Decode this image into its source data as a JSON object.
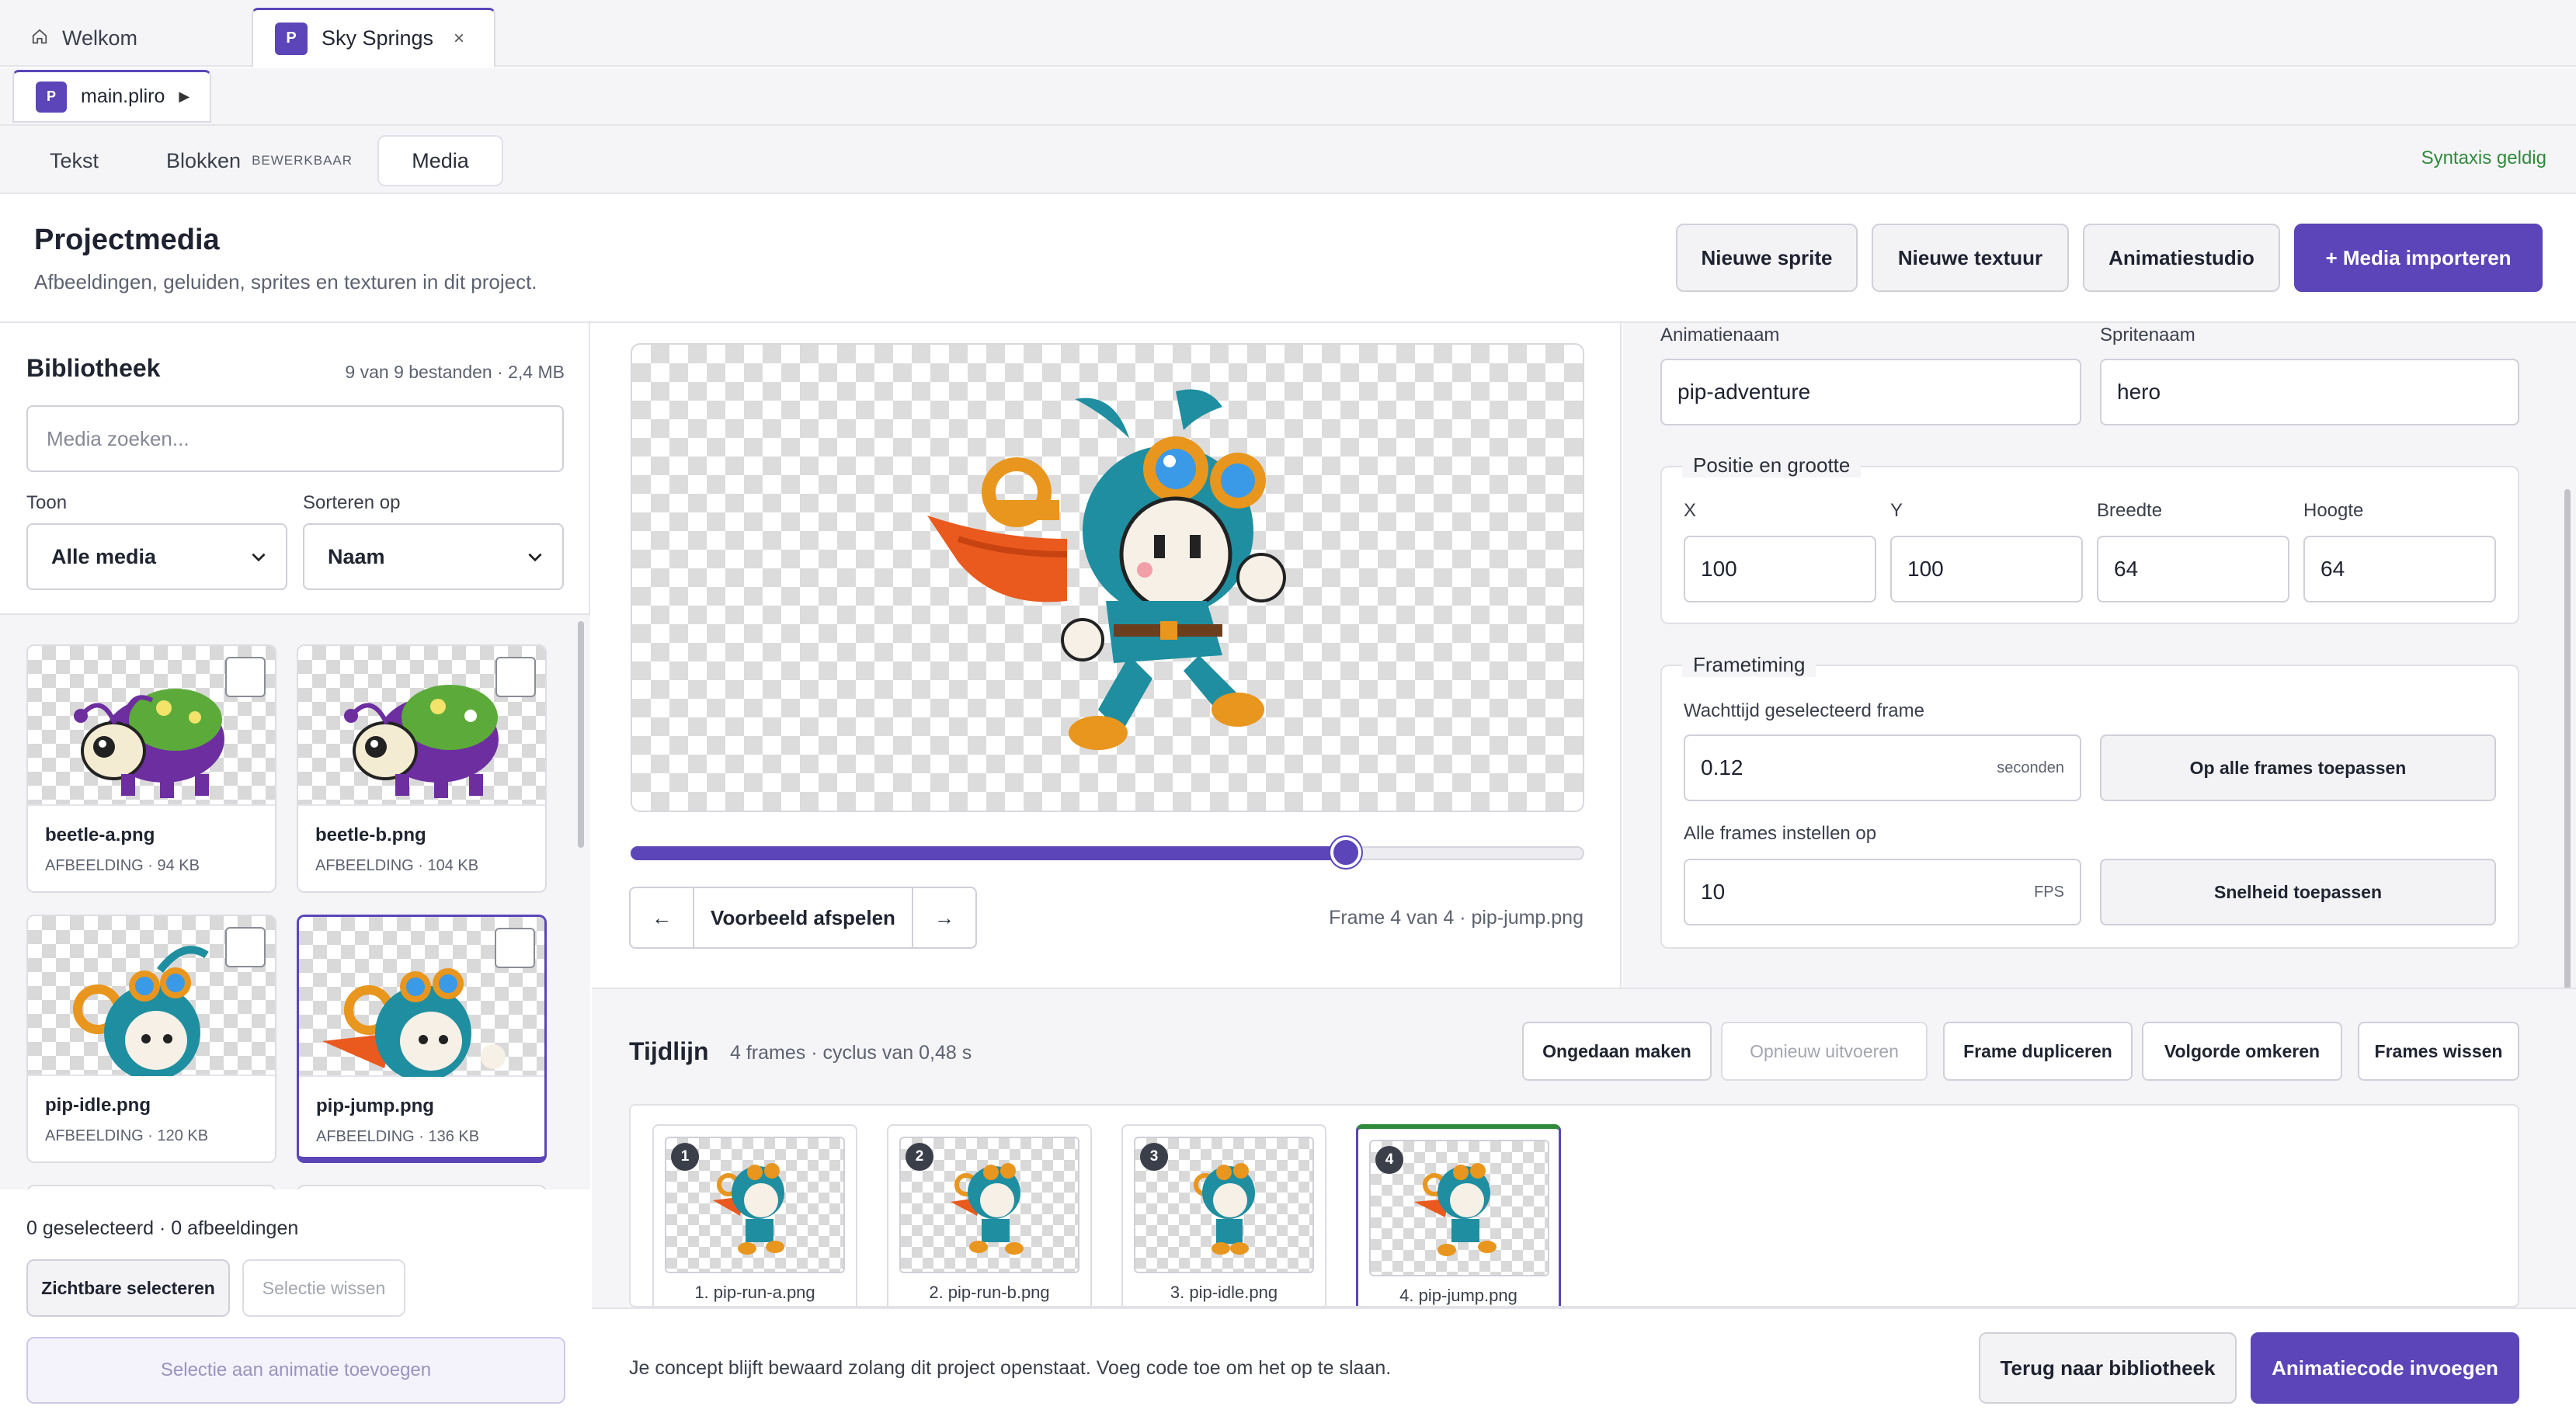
{
  "tabs": {
    "home_label": "Welkom",
    "project_label": "Sky Springs",
    "project_badge": "P",
    "close": "×"
  },
  "file": {
    "badge": "P",
    "name": "main.pliro"
  },
  "modes": {
    "text": "Tekst",
    "blocks": "Blokken",
    "blocks_badge": "BEWERKBAAR",
    "media": "Media",
    "syntax_status": "Syntaxis geldig"
  },
  "header": {
    "title": "Projectmedia",
    "subtitle": "Afbeeldingen, geluiden, sprites en texturen in dit project.",
    "btn_new_sprite": "Nieuwe sprite",
    "btn_new_texture": "Nieuwe textuur",
    "btn_anim_studio": "Animatiestudio",
    "btn_import": "+ Media importeren"
  },
  "library": {
    "title": "Bibliotheek",
    "count": "9 van 9 bestanden · 2,4 MB",
    "search_placeholder": "Media zoeken...",
    "show_label": "Toon",
    "show_value": "Alle media",
    "sort_label": "Sorteren op",
    "sort_value": "Naam",
    "items": [
      {
        "name": "beetle-a.png",
        "meta": "AFBEELDING · 94 KB"
      },
      {
        "name": "beetle-b.png",
        "meta": "AFBEELDING · 104 KB"
      },
      {
        "name": "pip-idle.png",
        "meta": "AFBEELDING · 120 KB"
      },
      {
        "name": "pip-jump.png",
        "meta": "AFBEELDING · 136 KB"
      }
    ],
    "selection_info": "0 geselecteerd · 0 afbeeldingen",
    "btn_select_visible": "Zichtbare selecteren",
    "btn_clear_selection": "Selectie wissen",
    "btn_add_to_animation": "Selectie aan animatie toevoegen"
  },
  "preview": {
    "progress": 0.75,
    "btn_prev": "←",
    "btn_play": "Voorbeeld afspelen",
    "btn_next": "→",
    "frame_info": "Frame 4 van 4 · pip-jump.png"
  },
  "settings": {
    "anim_name_label": "Animatienaam",
    "anim_name_value": "pip-adventure",
    "sprite_name_label": "Spritenaam",
    "sprite_name_value": "hero",
    "pos_legend": "Positie en grootte",
    "x_label": "X",
    "x_value": "100",
    "y_label": "Y",
    "y_value": "100",
    "w_label": "Breedte",
    "w_value": "64",
    "h_label": "Hoogte",
    "h_value": "64",
    "timing_legend": "Frametiming",
    "wait_label": "Wachttijd geselecteerd frame",
    "wait_value": "0.12",
    "wait_unit": "seconden",
    "btn_apply_all": "Op alle frames toepassen",
    "all_frames_label": "Alle frames instellen op",
    "fps_value": "10",
    "fps_unit": "FPS",
    "btn_apply_speed": "Snelheid toepassen"
  },
  "timeline": {
    "title": "Tijdlijn",
    "subtitle": "4 frames · cyclus van 0,48 s",
    "btn_undo": "Ongedaan maken",
    "btn_redo": "Opnieuw uitvoeren",
    "btn_duplicate": "Frame dupliceren",
    "btn_reverse": "Volgorde omkeren",
    "btn_clear": "Frames wissen",
    "frames": [
      {
        "num": "1",
        "name": "1. pip-run-a.png"
      },
      {
        "num": "2",
        "name": "2. pip-run-b.png"
      },
      {
        "num": "3",
        "name": "3. pip-idle.png"
      },
      {
        "num": "4",
        "name": "4. pip-jump.png"
      }
    ]
  },
  "footer": {
    "message": "Je concept blijft bewaard zolang dit project openstaat. Voeg code toe om het op te slaan.",
    "btn_back": "Terug naar bibliotheek",
    "btn_insert": "Animatiecode invoegen"
  },
  "colors": {
    "accent": "#5b45b8",
    "success": "#2f8a3a"
  }
}
